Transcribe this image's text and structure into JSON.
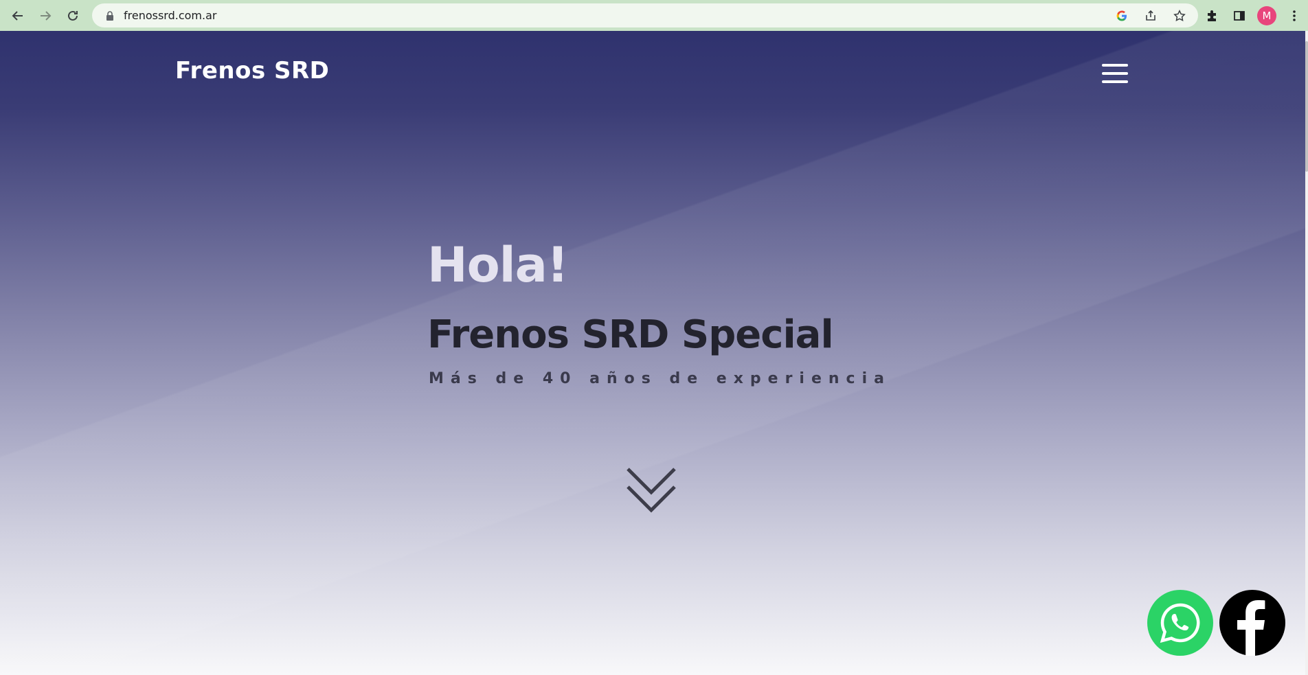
{
  "browser": {
    "url": "frenossrd.com.ar",
    "profile_initial": "M"
  },
  "site": {
    "logo": "Frenos SRD",
    "menu_icon": "hamburger-menu-icon"
  },
  "hero": {
    "greeting": "Hola!",
    "title": "Frenos SRD Special",
    "subtitle": "Más de 40 años de experiencia",
    "scroll_icon": "double-chevron-down-icon"
  },
  "floating_buttons": {
    "whatsapp_icon": "whatsapp-icon",
    "facebook_icon": "facebook-icon"
  },
  "colors": {
    "whatsapp": "#2bd366",
    "facebook": "#000000",
    "header_top": "#2f326e",
    "title_text": "#23232e",
    "greeting_text": "#e4e2ef"
  }
}
